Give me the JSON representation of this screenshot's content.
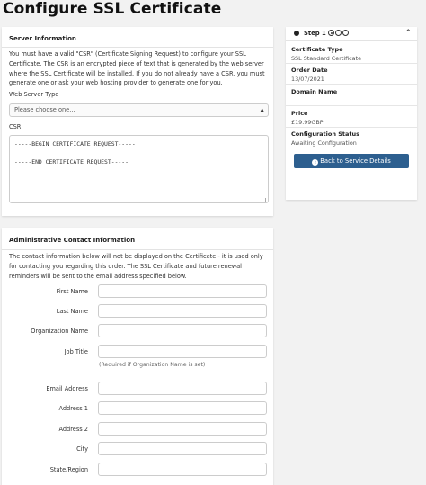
{
  "page": {
    "title": "Configure SSL Certificate"
  },
  "server_info": {
    "title": "Server Information",
    "description": "You must have a valid \"CSR\" (Certificate Signing Request) to configure your SSL Certificate. The CSR is an encrypted piece of text that is generated by the web server where the SSL Certificate will be installed. If you do not already have a CSR, you must generate one or ask your web hosting provider to generate one for you.",
    "web_server_type_label": "Web Server Type",
    "web_server_type_value": "Please choose one...",
    "csr_label": "CSR",
    "csr_value": "-----BEGIN CERTIFICATE REQUEST-----\n\n-----END CERTIFICATE REQUEST-----"
  },
  "admin_contact": {
    "title": "Administrative Contact Information",
    "description": "The contact information below will not be displayed on the Certificate - it is used only for contacting you regarding this order. The SSL Certificate and future renewal reminders will be sent to the email address specified below.",
    "fields": {
      "first_name": "First Name",
      "last_name": "Last Name",
      "organization_name": "Organization Name",
      "job_title": "Job Title",
      "job_title_help": "(Required if Organization Name is set)",
      "email": "Email Address",
      "address1": "Address 1",
      "address2": "Address 2",
      "city": "City",
      "state": "State/Region"
    }
  },
  "sidebar": {
    "step_label": "Step 1",
    "certificate_type_label": "Certificate Type",
    "certificate_type_value": "SSL Standard Certificate",
    "order_date_label": "Order Date",
    "order_date_value": "13/07/2021",
    "domain_name_label": "Domain Name",
    "domain_name_value": "",
    "price_label": "Price",
    "price_value": "£19.99GBP",
    "config_status_label": "Configuration Status",
    "config_status_value": "Awaiting Configuration",
    "back_button_label": "Back to Service Details"
  },
  "colors": {
    "primary_button": "#2d5f8f",
    "background": "#f2f2f2"
  },
  "icons": {
    "step_current": "filled-circle-icon",
    "collapse": "chevron-up-icon",
    "back": "arrow-left-circle-icon"
  }
}
